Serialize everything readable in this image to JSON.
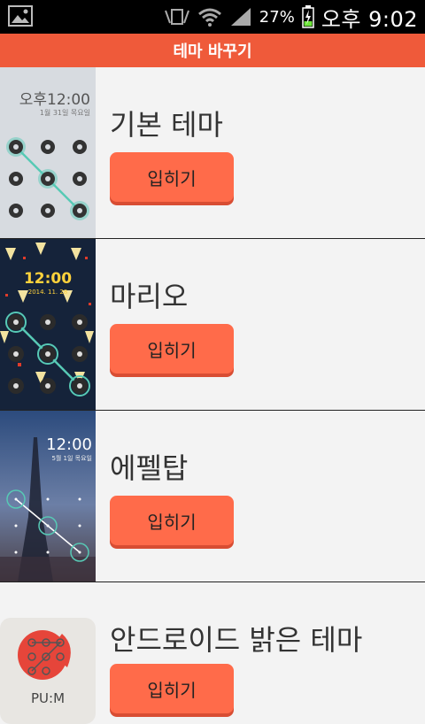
{
  "status_bar": {
    "battery": "27%",
    "time": "오후 9:02",
    "icons": [
      "image-icon",
      "vibrate-icon",
      "wifi-icon",
      "signal-icon",
      "battery-charging-icon"
    ]
  },
  "title": "테마 바꾸기",
  "themes": [
    {
      "name": "기본 테마",
      "button": "입히기",
      "preview_time": "오후12:00",
      "preview_date": "1월 31일 목요일"
    },
    {
      "name": "마리오",
      "button": "입히기",
      "preview_time": "12:00",
      "preview_date": "2014. 11. 28"
    },
    {
      "name": "에펠탑",
      "button": "입히기",
      "preview_time": "12:00",
      "preview_date": "5월 1일 목요일"
    },
    {
      "name": "안드로이드 밝은 테마",
      "button": "입히기",
      "preview_logo": "PU:M"
    }
  ],
  "colors": {
    "accent": "#ef5a3a",
    "button": "#ff6b4a",
    "background": "#f3f3f3"
  }
}
